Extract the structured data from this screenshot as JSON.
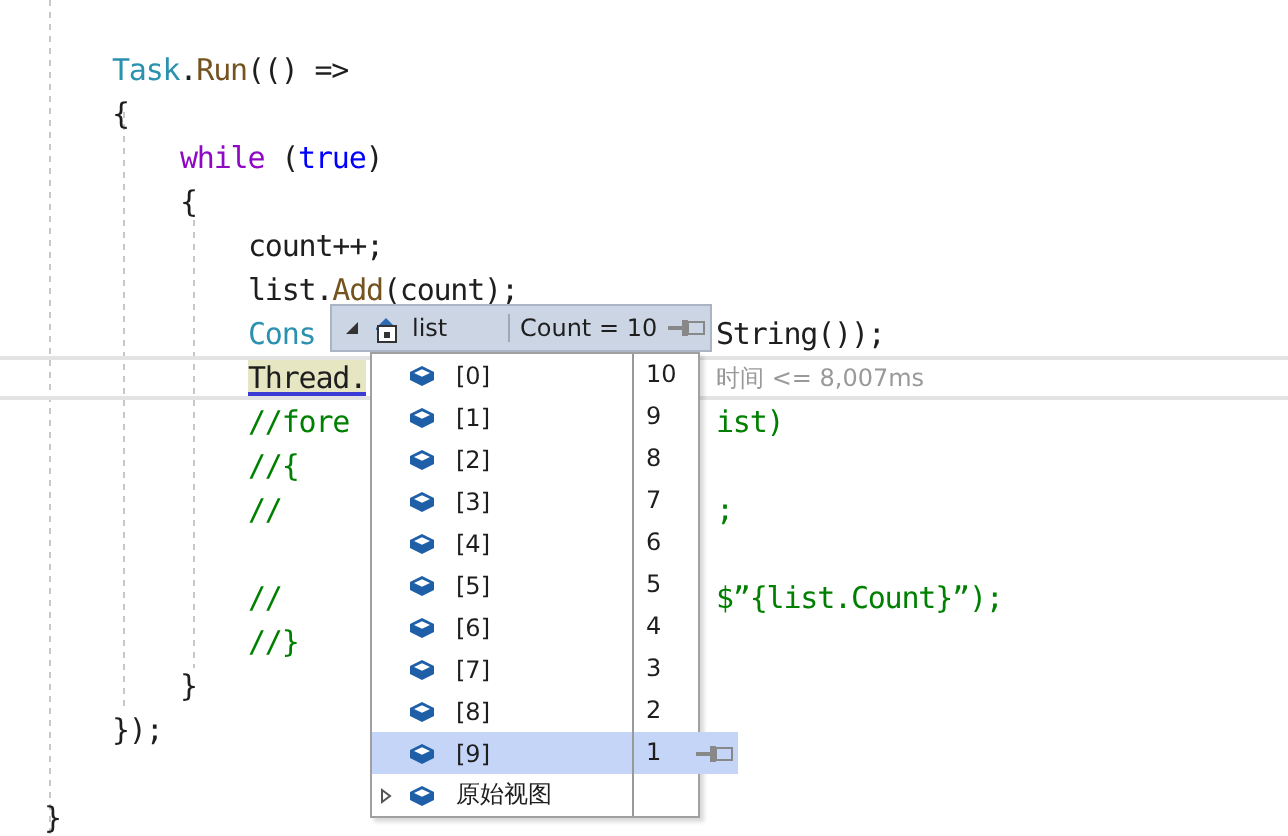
{
  "editor": {
    "lines": [
      {
        "kind": "blank"
      },
      {
        "kind": "block",
        "children": [
          {
            "kind": "code",
            "left": [
              {
                "text": "Task",
                "kind": "type"
              },
              {
                "text": ".",
                "kind": "plain"
              },
              {
                "text": "Run",
                "kind": "method"
              },
              {
                "text": "(() =>",
                "kind": "plain"
              }
            ]
          },
          {
            "kind": "code",
            "left": [
              {
                "text": "{",
                "kind": "plain"
              }
            ]
          },
          {
            "kind": "block",
            "children": [
              {
                "kind": "code",
                "left": [
                  {
                    "text": "while",
                    "kind": "control"
                  },
                  {
                    "text": " (",
                    "kind": "plain"
                  },
                  {
                    "text": "true",
                    "kind": "keyword"
                  },
                  {
                    "text": ")",
                    "kind": "plain"
                  }
                ]
              },
              {
                "kind": "code",
                "left": [
                  {
                    "text": "{",
                    "kind": "plain"
                  }
                ]
              },
              {
                "kind": "block",
                "children": [
                  {
                    "kind": "code",
                    "left": [
                      {
                        "text": "count++;",
                        "kind": "plain"
                      }
                    ]
                  },
                  {
                    "kind": "code",
                    "left": [
                      {
                        "text": "list.",
                        "kind": "plain"
                      },
                      {
                        "text": "Add",
                        "kind": "method"
                      },
                      {
                        "text": "(count);",
                        "kind": "plain"
                      }
                    ]
                  },
                  {
                    "kind": "code",
                    "left": [
                      {
                        "text": "Cons",
                        "kind": "type"
                      }
                    ],
                    "right": [
                      {
                        "text": "String());",
                        "kind": "plain"
                      }
                    ]
                  },
                  {
                    "kind": "code",
                    "current": true,
                    "left": [
                      {
                        "text": "Thread.",
                        "kind": "highlight"
                      }
                    ],
                    "right": [
                      {
                        "text": "时间 <= 8,007ms",
                        "kind": "hint"
                      }
                    ]
                  },
                  {
                    "kind": "code",
                    "left": [
                      {
                        "text": "//fore",
                        "kind": "comment"
                      }
                    ],
                    "right": [
                      {
                        "text": "ist)",
                        "kind": "comment"
                      }
                    ]
                  },
                  {
                    "kind": "code",
                    "left": [
                      {
                        "text": "//{",
                        "kind": "comment"
                      }
                    ]
                  },
                  {
                    "kind": "code",
                    "left": [
                      {
                        "text": "//",
                        "kind": "comment"
                      }
                    ],
                    "right": [
                      {
                        "text": ";",
                        "kind": "comment"
                      }
                    ]
                  },
                  {
                    "kind": "blank"
                  },
                  {
                    "kind": "code",
                    "left": [
                      {
                        "text": "//",
                        "kind": "comment"
                      }
                    ],
                    "right": [
                      {
                        "text": "$”{list.Count}”);",
                        "kind": "comment"
                      }
                    ]
                  },
                  {
                    "kind": "code",
                    "left": [
                      {
                        "text": "//}",
                        "kind": "comment"
                      }
                    ]
                  }
                ]
              },
              {
                "kind": "code",
                "left": [
                  {
                    "text": "}",
                    "kind": "plain"
                  }
                ]
              }
            ]
          },
          {
            "kind": "code",
            "left": [
              {
                "text": "});",
                "kind": "plain"
              }
            ]
          }
        ]
      },
      {
        "kind": "blank"
      },
      {
        "kind": "code",
        "left": [
          {
            "text": "}",
            "kind": "plain"
          }
        ]
      }
    ]
  },
  "datatip": {
    "name": "list",
    "value": "Count = 10",
    "expanded": true,
    "items": [
      {
        "kind": "element",
        "name": "[0]",
        "value": "10",
        "selected": false
      },
      {
        "kind": "element",
        "name": "[1]",
        "value": "9",
        "selected": false
      },
      {
        "kind": "element",
        "name": "[2]",
        "value": "8",
        "selected": false
      },
      {
        "kind": "element",
        "name": "[3]",
        "value": "7",
        "selected": false
      },
      {
        "kind": "element",
        "name": "[4]",
        "value": "6",
        "selected": false
      },
      {
        "kind": "element",
        "name": "[5]",
        "value": "5",
        "selected": false
      },
      {
        "kind": "element",
        "name": "[6]",
        "value": "4",
        "selected": false
      },
      {
        "kind": "element",
        "name": "[7]",
        "value": "3",
        "selected": false
      },
      {
        "kind": "element",
        "name": "[8]",
        "value": "2",
        "selected": false
      },
      {
        "kind": "element",
        "name": "[9]",
        "value": "1",
        "selected": true
      },
      {
        "kind": "raw_view",
        "name": "原始视图",
        "selected": false
      }
    ]
  }
}
